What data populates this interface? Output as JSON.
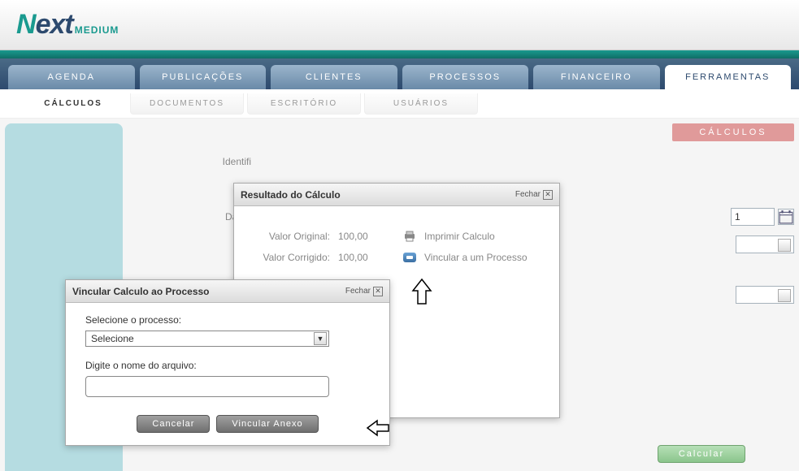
{
  "brand": {
    "name": "Next",
    "sub": "MEDIUM"
  },
  "nav": {
    "items": [
      {
        "label": "AGENDA"
      },
      {
        "label": "PUBLICAÇÕES"
      },
      {
        "label": "CLIENTES"
      },
      {
        "label": "PROCESSOS"
      },
      {
        "label": "FINANCEIRO"
      },
      {
        "label": "FERRAMENTAS"
      }
    ],
    "activeIndex": 5
  },
  "subnav": {
    "items": [
      {
        "label": "CÁLCULOS"
      },
      {
        "label": "DOCUMENTOS"
      },
      {
        "label": "ESCRITÓRIO"
      },
      {
        "label": "USUÁRIOS"
      }
    ],
    "activeIndex": 0
  },
  "page": {
    "badge": "CÁLCULOS",
    "form": {
      "label_identif": "Identifi",
      "label_data": "Data I",
      "date_value": "1"
    }
  },
  "resultModal": {
    "title": "Resultado do Cálculo",
    "close": "Fechar",
    "rows": {
      "label_original": "Valor Original:",
      "value_original": "100,00",
      "label_corrigido": "Valor Corrigido:",
      "value_corrigido": "100,00"
    },
    "actions": {
      "print": "Imprimir Calculo",
      "link": "Vincular a um Processo"
    }
  },
  "linkModal": {
    "title": "Vincular Calculo ao Processo",
    "close": "Fechar",
    "label_select": "Selecione o processo:",
    "select_value": "Selecione",
    "label_filename": "Digite o nome do arquivo:",
    "filename_value": "",
    "buttons": {
      "cancel": "Cancelar",
      "attach": "Vincular Anexo"
    }
  },
  "footer": {
    "calc_button": "Calcular"
  }
}
